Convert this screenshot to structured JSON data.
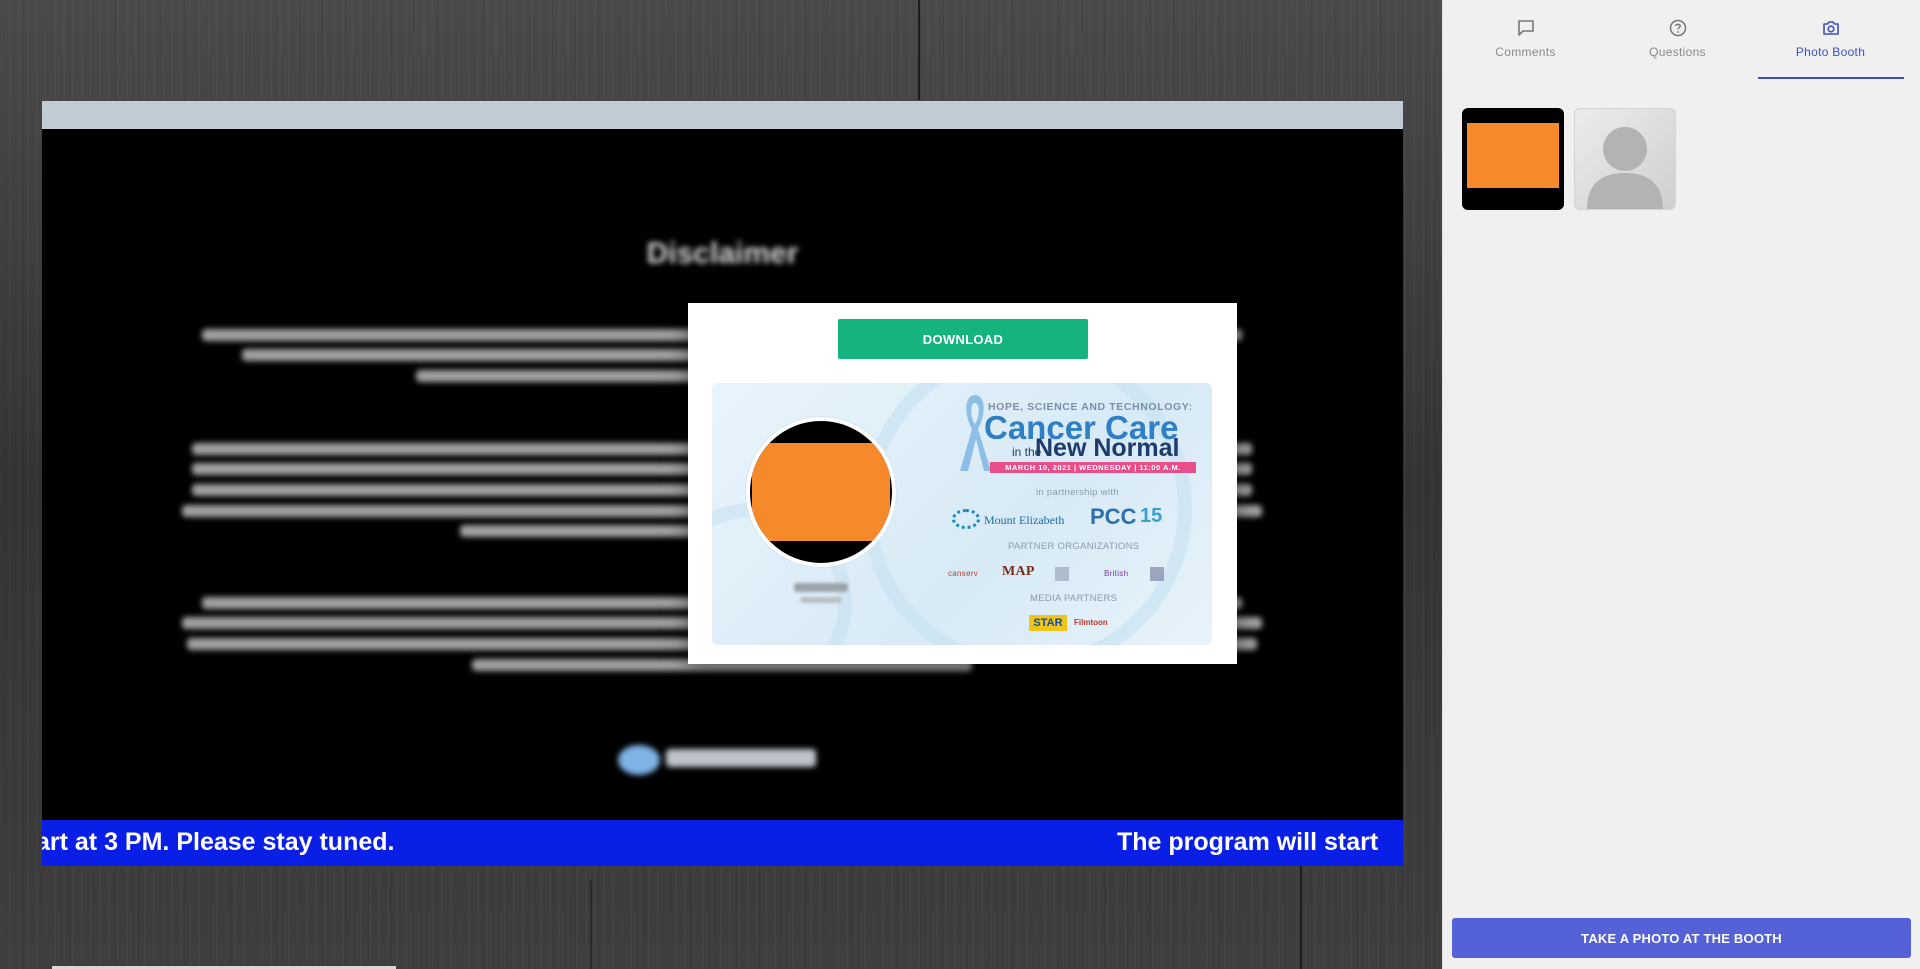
{
  "ticker": {
    "text_left": "art at 3 PM. Please stay tuned.",
    "text_right": "The program will start"
  },
  "slide": {
    "title": "Disclaimer"
  },
  "modal": {
    "download_label": "DOWNLOAD",
    "card": {
      "kicker": "HOPE, SCIENCE AND TECHNOLOGY:",
      "title_line1": "Cancer Care",
      "in_the": "in the",
      "title_line2": "New Normal",
      "date_line": "MARCH 10, 2021 | WEDNESDAY | 11:00 A.M.",
      "partnership": "in partnership with",
      "partner_orgs": "PARTNER ORGANIZATIONS",
      "media_partners": "MEDIA PARTNERS",
      "mount_elizabeth": "Mount Elizabeth",
      "pcc": "PCC",
      "fifteen": "15",
      "canserv": "canserv",
      "map": "MAP",
      "british": "British",
      "star": "STAR",
      "filmtoon": "Filmtoon"
    }
  },
  "sidebar": {
    "tabs": [
      {
        "label": "Comments",
        "icon": "comment-icon"
      },
      {
        "label": "Questions",
        "icon": "question-icon"
      },
      {
        "label": "Photo Booth",
        "icon": "camera-icon",
        "active": true
      }
    ],
    "take_photo_label": "TAKE A PHOTO AT THE BOOTH"
  },
  "colors": {
    "accent": "#3f4fc4",
    "button": "#5561d6",
    "download": "#15b37d",
    "ticker": "#0a1fe6",
    "photo_placeholder": "#f68a2a"
  }
}
